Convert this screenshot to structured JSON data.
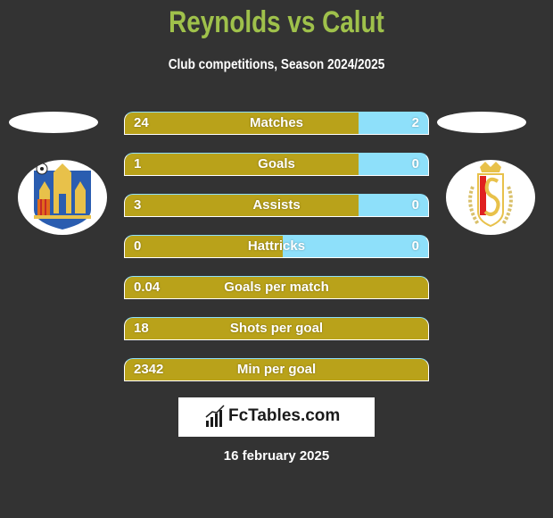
{
  "header": {
    "title": "Reynolds vs Calut",
    "subtitle": "Club competitions, Season 2024/2025"
  },
  "colors": {
    "background": "#333333",
    "title": "#9fc14b",
    "left_bar": "#b9a21a",
    "right_bar": "#8ee0fa"
  },
  "teams": {
    "left": {
      "logo_icon": "westerlo-crest-icon"
    },
    "right": {
      "logo_icon": "standard-liege-crest-icon"
    }
  },
  "stats": [
    {
      "label": "Matches",
      "left": "24",
      "right": "2",
      "left_share": 0.77
    },
    {
      "label": "Goals",
      "left": "1",
      "right": "0",
      "left_share": 0.77
    },
    {
      "label": "Assists",
      "left": "3",
      "right": "0",
      "left_share": 0.77
    },
    {
      "label": "Hattricks",
      "left": "0",
      "right": "0",
      "left_share": 0.52
    },
    {
      "label": "Goals per match",
      "left": "0.04",
      "right": "",
      "left_share": 1.0
    },
    {
      "label": "Shots per goal",
      "left": "18",
      "right": "",
      "left_share": 1.0
    },
    {
      "label": "Min per goal",
      "left": "2342",
      "right": "",
      "left_share": 1.0
    }
  ],
  "brand": {
    "name": "FcTables.com",
    "icon": "bar-chart-icon"
  },
  "date": "16 february 2025"
}
